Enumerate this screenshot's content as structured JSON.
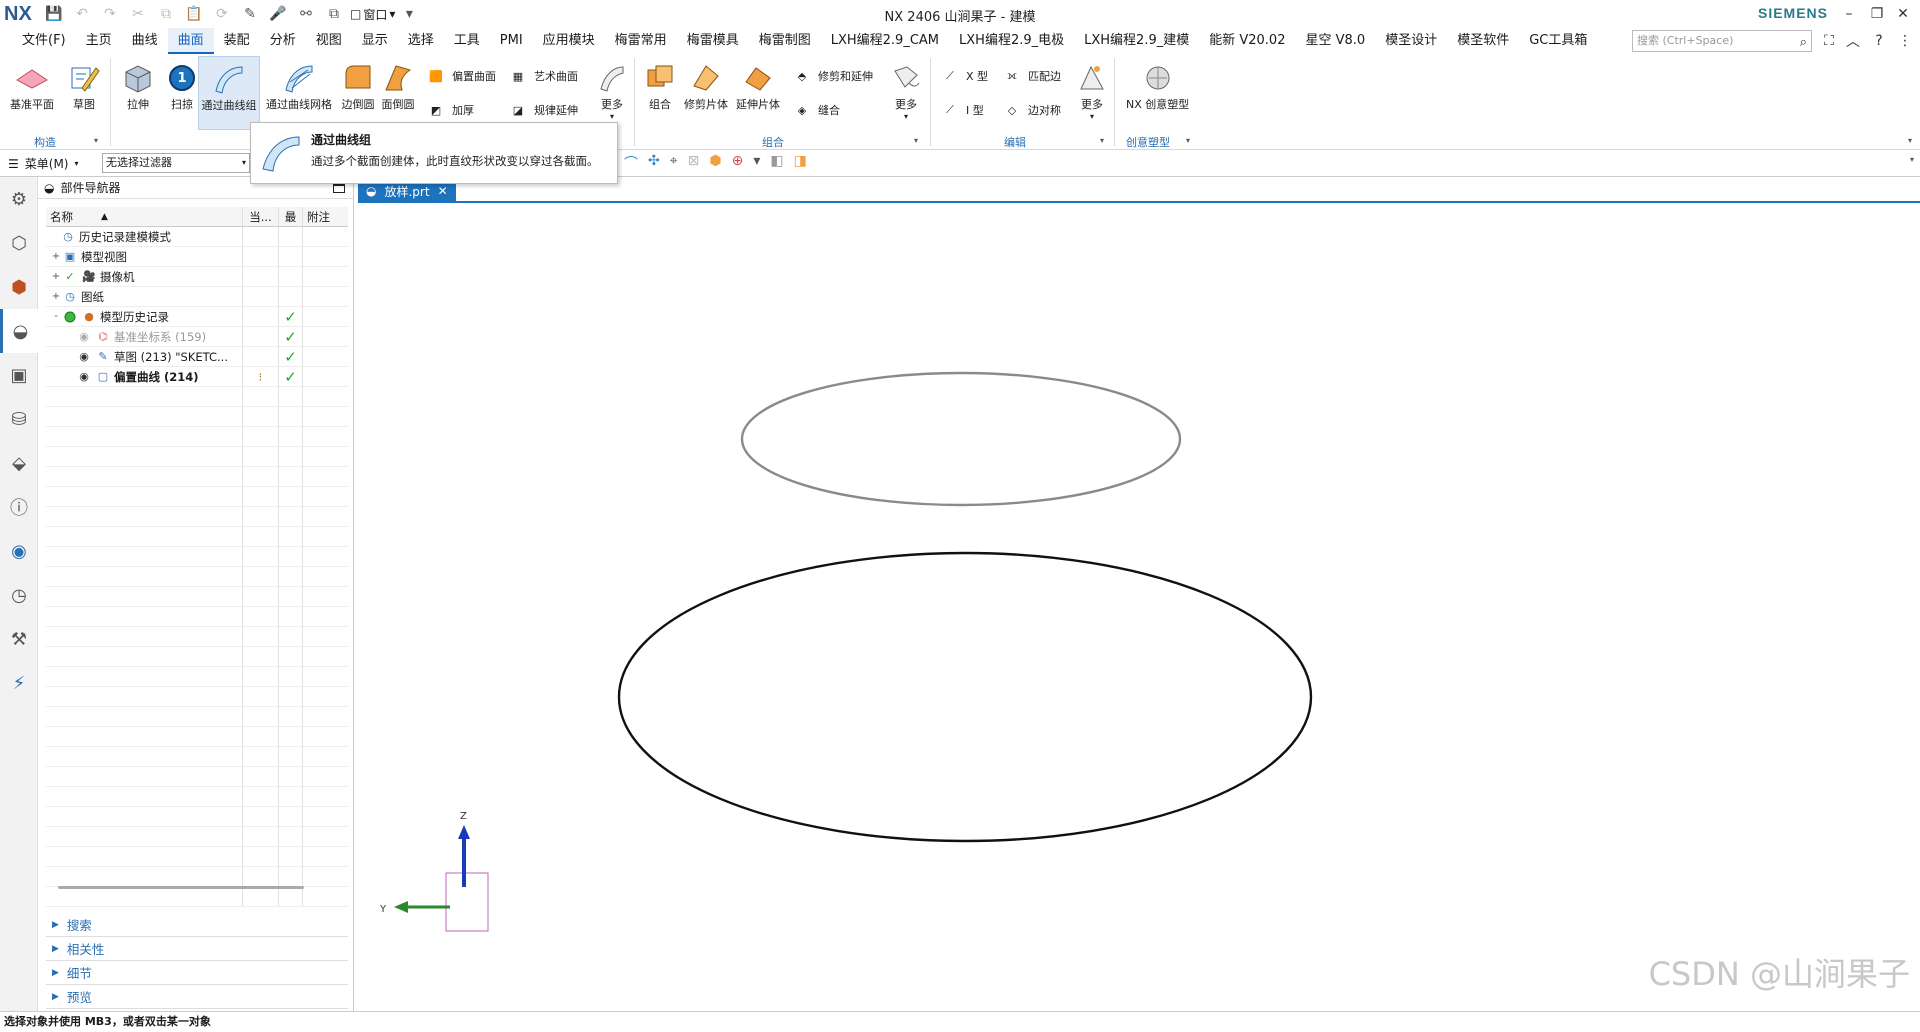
{
  "titlebar": {
    "logo": "NX",
    "title": "NX 2406 山涧果子 - 建模",
    "brand": "SIEMENS",
    "window_menu": "窗口"
  },
  "menubar": {
    "items": [
      "文件(F)",
      "主页",
      "曲线",
      "曲面",
      "装配",
      "分析",
      "视图",
      "显示",
      "选择",
      "工具",
      "PMI",
      "应用模块",
      "梅雷常用",
      "梅雷模具",
      "梅雷制图",
      "LXH编程2.9_CAM",
      "LXH编程2.9_电极",
      "LXH编程2.9_建模",
      "能新 V20.02",
      "星空 V8.0",
      "模圣设计",
      "模圣软件",
      "GC工具箱"
    ],
    "active_index": 3,
    "search_placeholder": "搜索 (Ctrl+Space)"
  },
  "ribbon": {
    "construct": {
      "label": "构造",
      "items": [
        "基准平面",
        "草图"
      ]
    },
    "base": {
      "items": [
        "拉伸",
        "扫掠",
        "通过曲线组",
        "通过曲线网格",
        "边倒圆",
        "面倒圆"
      ],
      "badge": "1"
    },
    "surface": {
      "items": [
        "偏置曲面",
        "艺术曲面",
        "加厚",
        "规律延伸",
        "更多"
      ]
    },
    "combine": {
      "label": "组合",
      "items": [
        "组合",
        "修剪片体",
        "延伸片体",
        "修剪和延伸",
        "缝合",
        "更多"
      ]
    },
    "edit": {
      "label": "编辑",
      "items": [
        "X 型",
        "匹配边",
        "I 型",
        "边对称",
        "更多"
      ]
    },
    "creative": {
      "label": "创意塑型",
      "items": [
        "NX 创意塑型"
      ]
    }
  },
  "toolbar": {
    "menu": "菜单(M)",
    "filter": "无选择过滤器"
  },
  "tooltip": {
    "title": "通过曲线组",
    "description": "通过多个截面创建体，此时直纹形状改变以穿过各截面。"
  },
  "navigator": {
    "title": "部件导航器",
    "columns": [
      "名称",
      "当...",
      "最",
      "附注"
    ],
    "rows": [
      {
        "label": "历史记录建模模式",
        "expand": "",
        "check": ""
      },
      {
        "label": "模型视图",
        "expand": "+",
        "check": ""
      },
      {
        "label": "摄像机",
        "expand": "+",
        "check": ""
      },
      {
        "label": "图纸",
        "expand": "+",
        "check": ""
      },
      {
        "label": "模型历史记录",
        "expand": "-",
        "check": "✓"
      },
      {
        "label": "基准坐标系 (159)",
        "expand": "",
        "check": "✓"
      },
      {
        "label": "草图 (213) \"SKETC...",
        "expand": "",
        "check": "✓"
      },
      {
        "label": "偏置曲线 (214)",
        "expand": "",
        "check": "✓"
      }
    ],
    "sections": [
      "搜索",
      "相关性",
      "细节",
      "预览"
    ]
  },
  "document": {
    "tab": "放样.prt"
  },
  "viewport": {
    "axis_z": "Z",
    "axis_y": "Y",
    "watermark": "CSDN @山涧果子"
  },
  "status": {
    "text": "选择对象并使用 MB3，或者双击某一对象"
  },
  "colors": {
    "accent": "#1e73be",
    "check": "#22a822"
  }
}
